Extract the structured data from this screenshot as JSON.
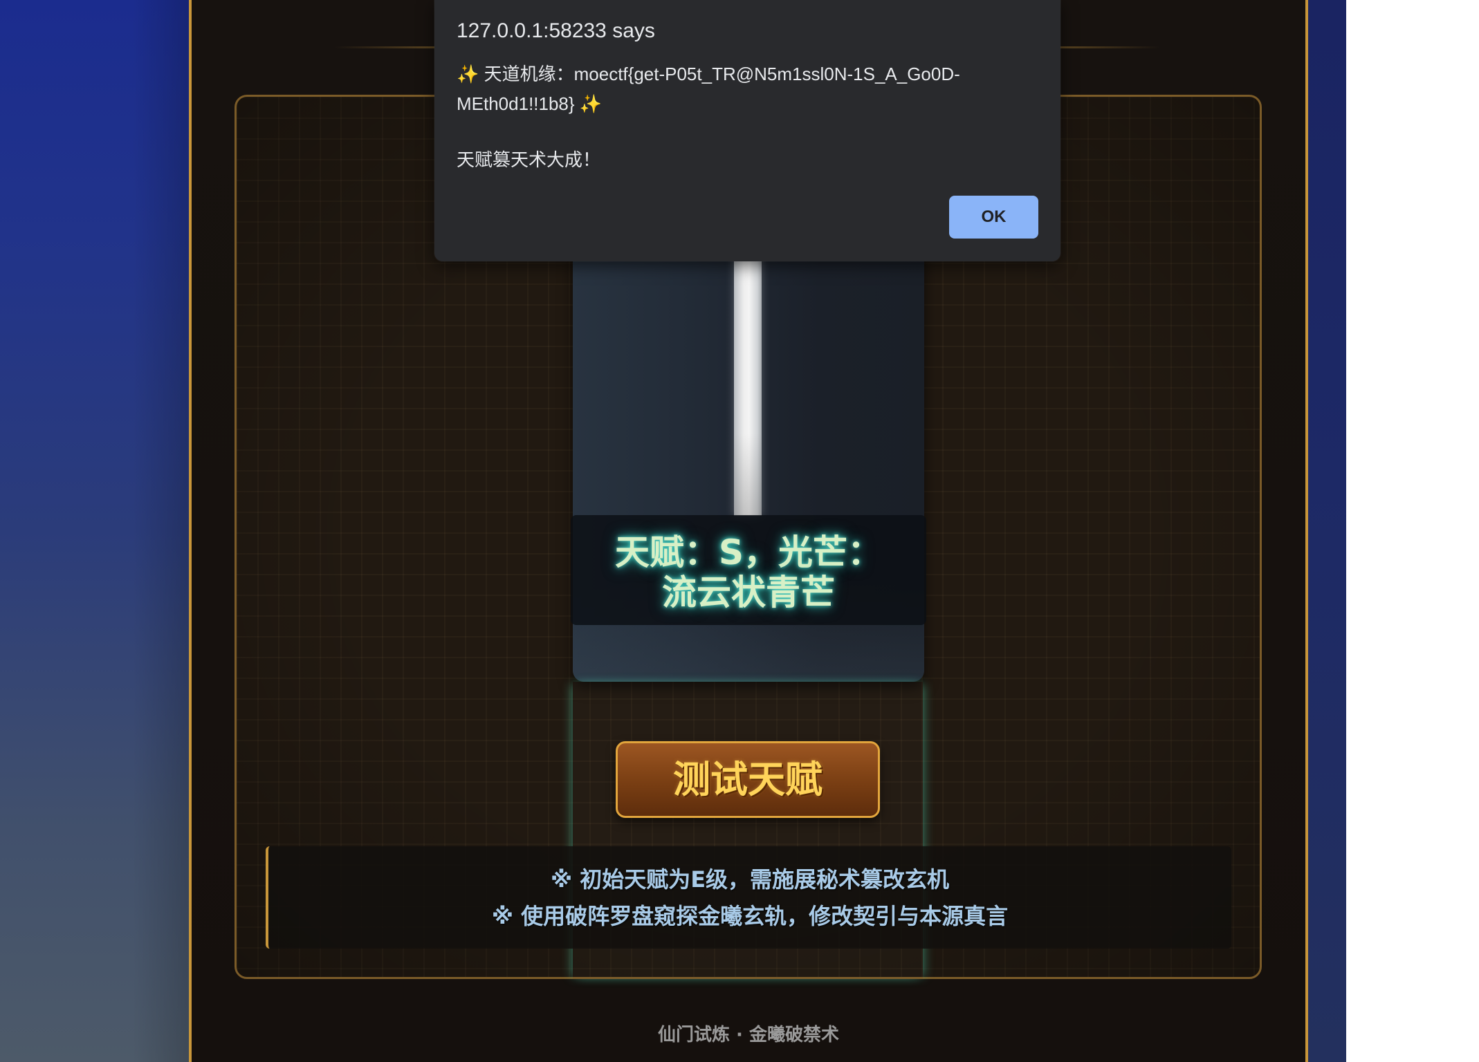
{
  "talent_display": {
    "line1": "天赋：S，光芒：",
    "line2": "流云状青芒"
  },
  "test_button": {
    "label": "测试天赋"
  },
  "hints": [
    "※ 初始天赋为E级，需施展秘术篡改玄机",
    "※ 使用破阵罗盘窥探金曦玄轨，修改契引与本源真言"
  ],
  "footer": {
    "text": "仙门试炼 · 金曦破禁术"
  },
  "dialog": {
    "title": "127.0.0.1:58233 says",
    "sparkle": "✨",
    "message_line1": "天道机缘：moectf{get-P05t_TR@N5m1ssl0N-1S_A_Go0D-",
    "message_line2": "MEth0d1!!1b8}",
    "message_line3": "天赋篡天术大成！",
    "ok_label": "OK"
  },
  "colors": {
    "gold_accent": "#c8963a",
    "talent_glow": "#4fd1c5",
    "button_text": "#ffd45a",
    "hint_text": "#a9cbe8",
    "dialog_background": "#292a2d",
    "dialog_ok_button": "#8ab4f8"
  }
}
